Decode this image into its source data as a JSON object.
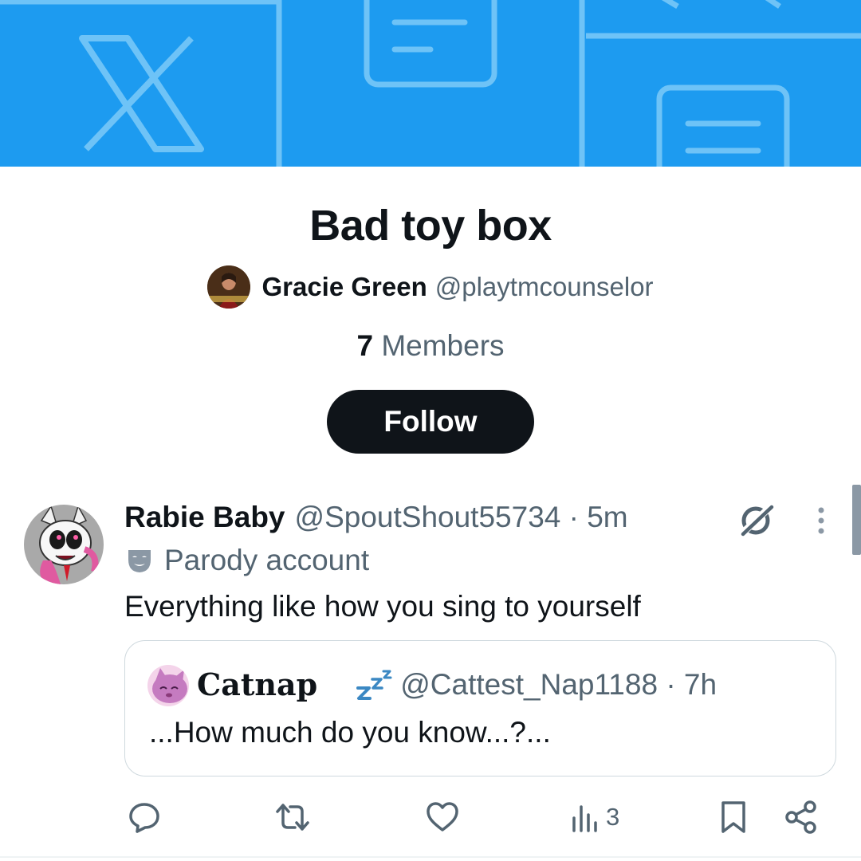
{
  "list": {
    "title": "Bad toy box",
    "owner_name": "Gracie Green",
    "owner_handle": "@playtmcounselor",
    "member_count": "7",
    "members_label": "Members",
    "follow_label": "Follow"
  },
  "post": {
    "author_name": "Rabie Baby",
    "meta": "@SpoutShout55734 · 5m",
    "parody_label": "Parody account",
    "text": "Everything like how you sing to yourself",
    "quote": {
      "author_name": "Catnap",
      "meta": "@Cattest_Nap1188 · 7h",
      "text": "...How much do you know...?..."
    },
    "actions": {
      "views_count": "3"
    }
  },
  "colors": {
    "banner": "#1d9bf0",
    "text_primary": "#0f1419",
    "text_secondary": "#536471",
    "follow_button": "#0f1419"
  },
  "icons": [
    "x-logo-icon",
    "list-icon",
    "grok-icon",
    "more-icon",
    "parody-mask-icon",
    "crescent-moon-emoji",
    "zzz-emoji",
    "reply-icon",
    "repost-icon",
    "like-icon",
    "views-icon",
    "bookmark-icon",
    "share-icon"
  ]
}
